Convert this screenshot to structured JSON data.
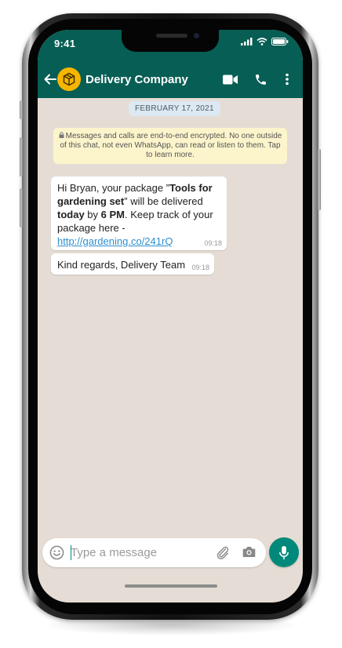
{
  "status_bar": {
    "time": "9:41"
  },
  "header": {
    "contact_name": "Delivery Company",
    "icons": [
      "back-arrow-icon",
      "package-avatar-icon",
      "video-call-icon",
      "phone-call-icon",
      "more-options-icon"
    ]
  },
  "chat": {
    "date": "FEBRUARY 17, 2021",
    "encryption_notice": "Messages and calls are end-to-end encrypted. No one outside of this chat, not even WhatsApp, can read or listen to them. Tap to learn more.",
    "messages": [
      {
        "parts": {
          "t1": "Hi Bryan, your package ”",
          "b1": "Tools for gardening set",
          "t2": "” will be delivered ",
          "b2": "today",
          "t3": " by ",
          "b3": "6 PM",
          "t4": ". Keep track of your package here - ",
          "link": "http://gardening.co/241rQ"
        },
        "time": "09:18"
      },
      {
        "text": "Kind regards, Delivery Team",
        "time": "09:18"
      }
    ]
  },
  "composer": {
    "placeholder": "Type a message",
    "value": ""
  },
  "colors": {
    "header": "#075e54",
    "accent": "#00897b",
    "chat_background": "#e5ddd5",
    "avatar": "#f7b500",
    "notice_background": "#fcf4cb",
    "date_chip": "#dce8f2",
    "link": "#2d8fd0"
  }
}
